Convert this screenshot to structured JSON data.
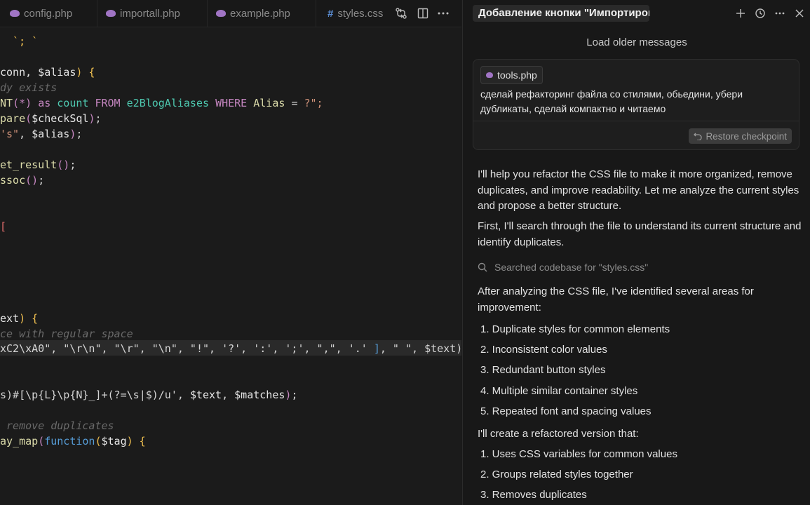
{
  "editor": {
    "tabs": [
      {
        "label": "config.php",
        "icon": "php-icon"
      },
      {
        "label": "importall.php",
        "icon": "php-icon"
      },
      {
        "label": "example.php",
        "icon": "php-icon"
      },
      {
        "label": "styles.css",
        "icon": "css-icon"
      }
    ],
    "toolbar": {
      "compare_icon": "compare-changes-icon",
      "split_icon": "split-editor-icon",
      "more_icon": "more-actions-icon"
    }
  },
  "panel": {
    "title": "Добавление кнопки \"Импортирова",
    "header_icons": [
      "new-chat-icon",
      "history-icon",
      "more-icon",
      "close-icon"
    ],
    "load_older": "Load older messages",
    "user_message": {
      "attachment": "tools.php",
      "text": "сделай рефакторинг файла со стилями, обьедини, убери дубликаты, сделай компактно и читаемо",
      "restore_label": "Restore checkpoint"
    },
    "response": {
      "p1": "I'll help you refactor the CSS file to make it more organized, remove duplicates, and improve readability. Let me analyze the current styles and propose a better structure.",
      "p2": "First, I'll search through the file to understand its current structure and identify duplicates.",
      "search_text": "Searched codebase for \"styles.css\"",
      "p3": "After analyzing the CSS file, I've identified several areas for improvement:",
      "list1": [
        "1. Duplicate styles for common elements",
        "2. Inconsistent color values",
        "3. Redundant button styles",
        "4. Multiple similar container styles",
        "5. Repeated font and spacing values"
      ],
      "p4": "I'll create a refactored version that:",
      "list2": [
        "1. Uses CSS variables for common values",
        "2. Groups related styles together",
        "3. Removes duplicates"
      ]
    }
  },
  "colors": {
    "editor_bg": "#1b1b1b",
    "panel_bg": "#181818",
    "accent_php": "#a074c4",
    "accent_css": "#5c8fd6"
  }
}
